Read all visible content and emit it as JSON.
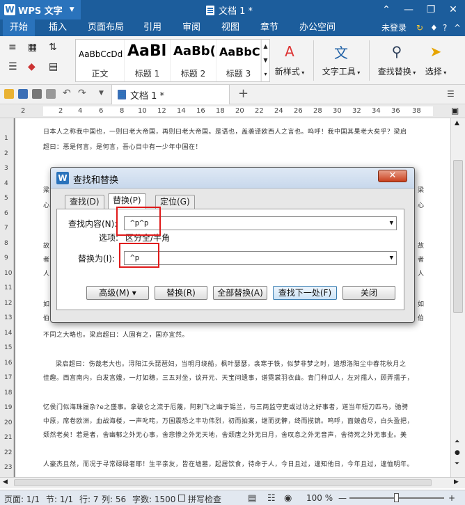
{
  "app": {
    "name": "WPS 文字",
    "doc_title": "文档 1 *"
  },
  "menu": {
    "tabs": [
      "开始",
      "插入",
      "页面布局",
      "引用",
      "审阅",
      "视图",
      "章节",
      "办公空间"
    ],
    "login": "未登录"
  },
  "ribbon": {
    "styles": [
      {
        "sample": "AaBbCcDd",
        "caption": "正文"
      },
      {
        "sample": "AaBl",
        "caption": "标题 1"
      },
      {
        "sample": "AaBb(",
        "caption": "标题 2"
      },
      {
        "sample": "AaBbC",
        "caption": "标题 3"
      }
    ],
    "new_style": "新样式",
    "text_tools": "文字工具",
    "find_replace": "查找替换",
    "select": "选择"
  },
  "quick": {
    "doc_tab": "文档 1 *",
    "add_tab": "+"
  },
  "ruler": {
    "numbers": [
      "2",
      "2",
      "4",
      "6",
      "8",
      "10",
      "12",
      "14",
      "16",
      "18",
      "20",
      "22",
      "24",
      "26",
      "28",
      "30",
      "32",
      "34",
      "36",
      "38"
    ]
  },
  "vruler": [
    "1",
    "2",
    "3",
    "4",
    "5",
    "6",
    "7",
    "8",
    "9",
    "10",
    "11",
    "12",
    "13",
    "14",
    "15",
    "16",
    "17",
    "18",
    "19",
    "20",
    "21",
    "22",
    "23",
    "24"
  ],
  "document": {
    "lines": [
      "日本人之称我中国也，一则曰老大帝国，再则曰老大帝国。是语也，盖袭译欧西人之言也。呜呼！我中国其果老大矣乎？梁启",
      "超曰：恶是何言，是何言，吾心目中有一少年中国在！",
      "",
      "",
      "梁",
      "心",
      "",
      "故",
      "者",
      "人",
      "",
      "如",
      "伯",
      "不同之大略也。梁启超曰：人固有之，国亦宜然。",
      "",
      "梁启超曰：伤哉老大也。浔阳江头琵琶妇，当明月绕船，枫叶瑟瑟，衾寒于铁，似梦非梦之时，追想洛阳尘中春花秋月之",
      "佳趣。西宫南内，白发宫娥，一灯如穗，三五对坐，谈开元、天宝间遗事，谱霓裳羽衣曲。青门种瓜人，左对孺人，顾弄孺子，",
      "",
      "忆侯门似海珠履杂?e之盛事。拿破仑之流于厄蔑，阿剌飞之幽于锡兰，与三两监守吏或过访之好事者，道当年短刀匹马，驰骋",
      "中原，席卷欧洲，血战海楼，一声叱咤，万国震恐之丰功伟烈，初而拍案，继而抚髀，终而揽镜。呜呼，面皴齿尽，白头盈把，",
      "颓然老矣！若是者，舍幽郁之外无心事，舍悲惨之外无天地，舍颓唐之外无日月，舍叹息之外无音声，舍待死之外无事业。美",
      "",
      "人豪杰且然，而况于寻常碌碌者耶！生平亲友，皆在墟墓，起居饮食，待命于人，今日且过，遑知他日，今年且过，遑恤明年。"
    ],
    "right_chars": [
      "梁",
      "心",
      "故",
      "者",
      "人",
      "如",
      "伯"
    ]
  },
  "dialog": {
    "title": "查找和替换",
    "tabs": [
      "查找(D)",
      "替换(P)",
      "定位(G)"
    ],
    "find_label": "查找内容(N):",
    "find_value": "^p^p",
    "options_label": "选项:",
    "options_value": "区分全/半角",
    "replace_label": "替换为(I):",
    "replace_value": "^p",
    "buttons": [
      "高级(M) ▾",
      "替换(R)",
      "全部替换(A)",
      "查找下一处(F)",
      "关闭"
    ],
    "close_glyph": "✕"
  },
  "status": {
    "page": "页面: 1/1",
    "section": "节: 1/1",
    "row": "行: 7",
    "col": "列: 56",
    "words": "字数: 1500",
    "spell": "拼写检查",
    "zoom": "100 %"
  }
}
